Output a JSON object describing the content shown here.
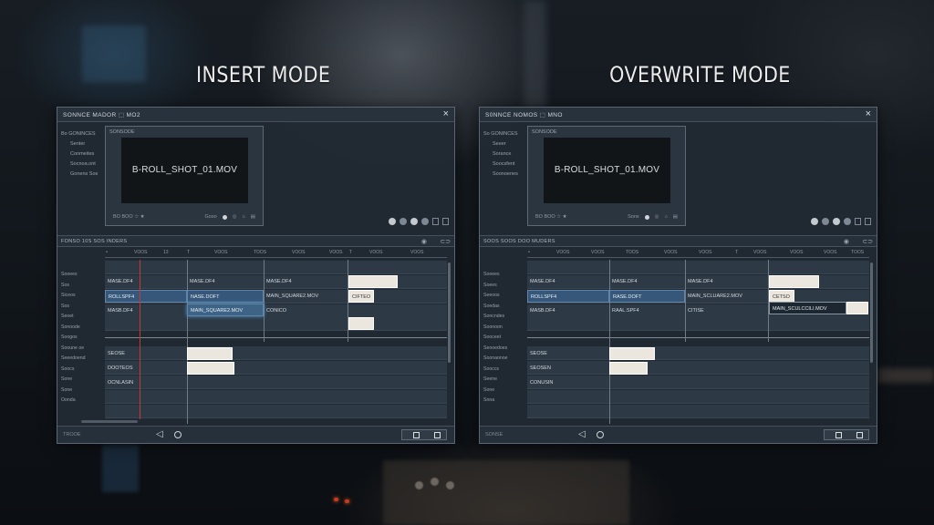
{
  "panels": [
    {
      "id": "insert",
      "heading": "INSERT MODE",
      "window_title": "SONNCE   MADOR  ⬚  MO2",
      "sources": [
        "Bo  GONINCES",
        "Senter",
        "Conmeites",
        "Socnoa.ont",
        "Gonens Sos"
      ],
      "monitor_title": "SONSODE",
      "clip_name": "B-ROLL_SHOT_01.MOV",
      "monitor_controls": {
        "left": "BO  BOO  ☆  ★",
        "right": "Goso"
      },
      "timeline_label": "FONSO 10S   SOS INDERS",
      "ruler_ticks": [
        "VOOS",
        "13",
        "T",
        "VOOS",
        "TOOS",
        "VOOS",
        "VOOS",
        "T",
        "VOOS",
        "VOOS"
      ],
      "track_labels": [
        "Sooees",
        "Sos",
        "Siceos",
        "Sos",
        "Seoet",
        "Sonoode",
        "Soogos",
        "Sooune oe",
        "Seeedoend",
        "Soocs",
        "Sone",
        "Sone",
        "Oonda"
      ],
      "clips": {
        "r1c1": "MASE.DF4",
        "r1c2": "MASE.DF4",
        "r1c3": "MASE.DF4",
        "r2c1": "ROLLSPF4",
        "r2c2": "NASE.DOFT",
        "r2c3": "MAIN_SQUARE2.MOV",
        "r2c4": "CIFTEO",
        "r3c1": "MASB.DF4",
        "r3c2": "MAIN_SQUARE2.MOV",
        "r3c3": "CONICO",
        "r4c1": "SEOSE",
        "r5c1": "DOOTEOS",
        "r6c1": "OCNLASIN"
      },
      "status": "TROOE"
    },
    {
      "id": "overwrite",
      "heading": "OVERWRITE MODE",
      "window_title": "S0NNCE  NOMOS  ⬚  MNO",
      "sources": [
        "So  GONINCES",
        "Seeer",
        "Sorance",
        "Soocsfent",
        "Soonoenes"
      ],
      "monitor_title": "SONSODE",
      "clip_name": "B-ROLL_SHOT_01.MOV",
      "monitor_controls": {
        "left": "BO  BOO  ☆  ★",
        "right": "Sons"
      },
      "timeline_label": "SOOS SOOS   DOO MUDERS",
      "ruler_ticks": [
        "VOOS",
        "VOOS",
        "TOOS",
        "VOOS",
        "VOOS",
        "T",
        "VOOS",
        "VOOS",
        "VOOS",
        "TOOS"
      ],
      "track_labels": [
        "Sooees",
        "Soees",
        "Seeoos",
        "Soedas",
        "Soncndes",
        "Soonoon",
        "Sooceet",
        "Seooedoes",
        "Soonaonoe",
        "Sooccs",
        "Seene",
        "Sone",
        "Snna"
      ],
      "clips": {
        "r1c1": "MASE.DF4",
        "r1c2": "MASE.DF4",
        "r1c3": "MASE.DF4",
        "r2c1": "ROLLSPF4",
        "r2c2": "RASE.DOFT",
        "r2c3": "MAIN_SCLUARE2.MOV",
        "r2c4": "CETSO",
        "r3c1": "MASB.DF4",
        "r3c2": "RAAL.SPF4",
        "r3c3": "CITISE",
        "r3c4": "MAIN_SCULCCILI.MOV",
        "r4c1": "SEOSE",
        "r5c1": "SEOSEN",
        "r6c1": "CONUSIN"
      },
      "status": "SONSE"
    }
  ]
}
